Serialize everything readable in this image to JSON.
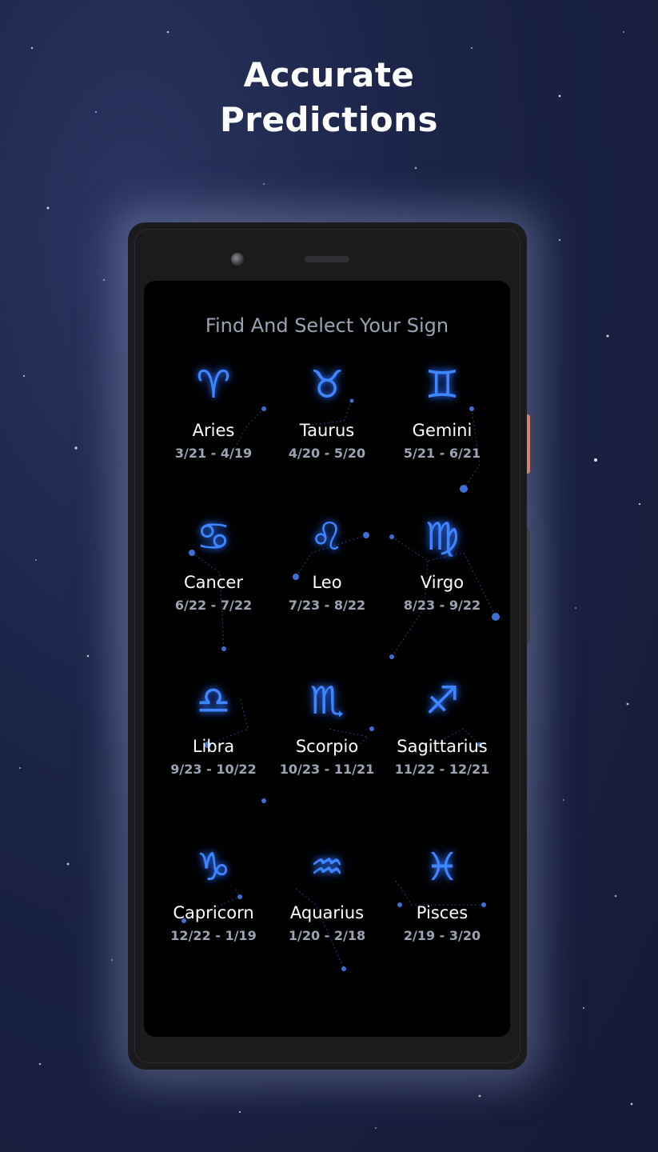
{
  "headline": {
    "line1": "Accurate",
    "line2": "Predictions"
  },
  "screen": {
    "title": "Find And Select Your Sign"
  },
  "signs": [
    {
      "name": "Aries",
      "dates": "3/21 - 4/19",
      "glyph": "♈︎",
      "icon": "aries-icon"
    },
    {
      "name": "Taurus",
      "dates": "4/20 - 5/20",
      "glyph": "♉︎",
      "icon": "taurus-icon"
    },
    {
      "name": "Gemini",
      "dates": "5/21 - 6/21",
      "glyph": "♊︎",
      "icon": "gemini-icon"
    },
    {
      "name": "Cancer",
      "dates": "6/22 - 7/22",
      "glyph": "♋︎",
      "icon": "cancer-icon"
    },
    {
      "name": "Leo",
      "dates": "7/23 - 8/22",
      "glyph": "♌︎",
      "icon": "leo-icon"
    },
    {
      "name": "Virgo",
      "dates": "8/23 - 9/22",
      "glyph": "♍︎",
      "icon": "virgo-icon"
    },
    {
      "name": "Libra",
      "dates": "9/23 - 10/22",
      "glyph": "♎︎",
      "icon": "libra-icon"
    },
    {
      "name": "Scorpio",
      "dates": "10/23 - 11/21",
      "glyph": "♏︎",
      "icon": "scorpio-icon"
    },
    {
      "name": "Sagittarius",
      "dates": "11/22 - 12/21",
      "glyph": "♐︎",
      "icon": "sagittarius-icon"
    },
    {
      "name": "Capricorn",
      "dates": "12/22 - 1/19",
      "glyph": "♑︎",
      "icon": "capricorn-icon"
    },
    {
      "name": "Aquarius",
      "dates": "1/20 - 2/18",
      "glyph": "♒︎",
      "icon": "aquarius-icon"
    },
    {
      "name": "Pisces",
      "dates": "2/19 - 3/20",
      "glyph": "♓︎",
      "icon": "pisces-icon"
    }
  ],
  "colors": {
    "glyph": "#3d86ff",
    "glow": "#2f6fff",
    "accent_button": "#e2704f",
    "screen_bg": "#000000",
    "title_text": "#9aa3b5"
  }
}
